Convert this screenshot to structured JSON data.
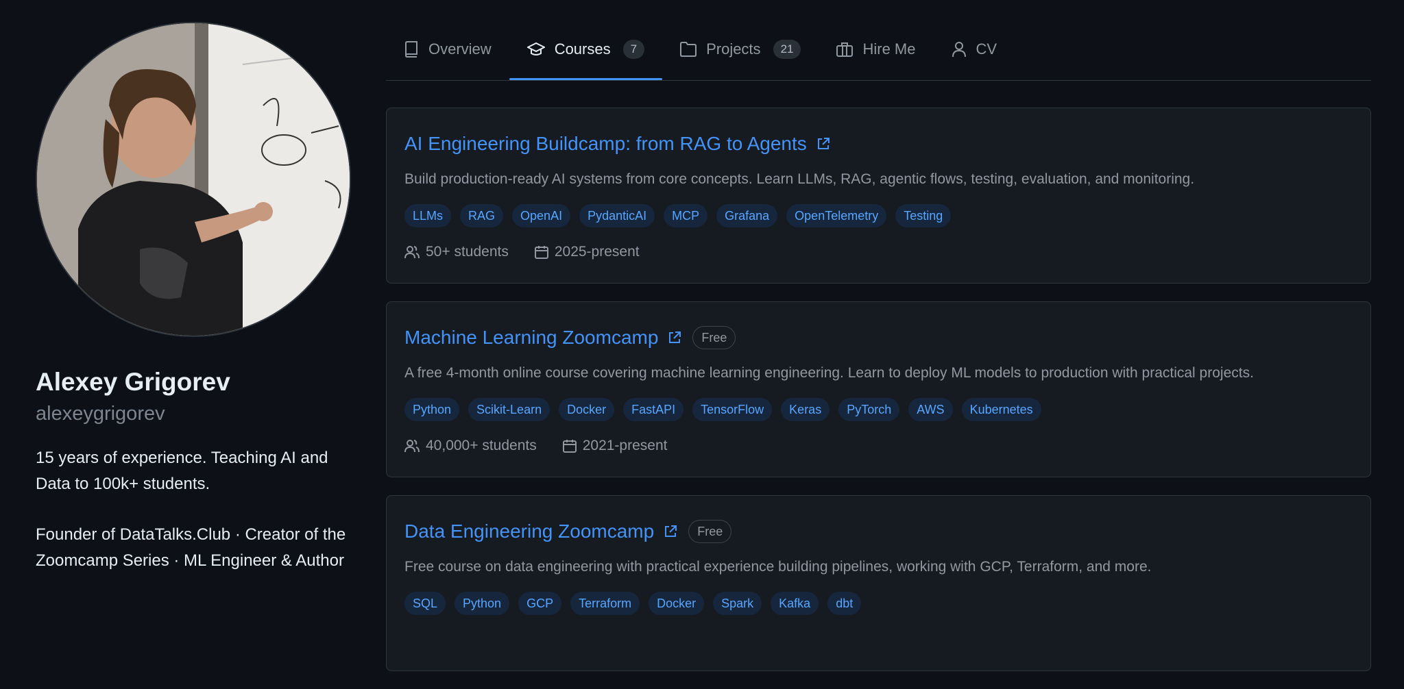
{
  "profile": {
    "name": "Alexey Grigorev",
    "username": "alexeygrigorev",
    "bio_line1": "15 years of experience. Teaching AI and Data to 100k+ students.",
    "bio_line2": "Founder of DataTalks.Club · Creator of the Zoomcamp Series · ML Engineer & Author"
  },
  "tabs": [
    {
      "label": "Overview",
      "icon": "book-icon",
      "count": null
    },
    {
      "label": "Courses",
      "icon": "graduation-cap-icon",
      "count": "7",
      "active": true
    },
    {
      "label": "Projects",
      "icon": "folder-icon",
      "count": "21"
    },
    {
      "label": "Hire Me",
      "icon": "briefcase-icon",
      "count": null
    },
    {
      "label": "CV",
      "icon": "person-icon",
      "count": null
    }
  ],
  "courses": [
    {
      "title": "AI Engineering Buildcamp: from RAG to Agents",
      "badge": "",
      "description": "Build production-ready AI systems from core concepts. Learn LLMs, RAG, agentic flows, testing, evaluation, and monitoring.",
      "tags": [
        "LLMs",
        "RAG",
        "OpenAI",
        "PydanticAI",
        "MCP",
        "Grafana",
        "OpenTelemetry",
        "Testing"
      ],
      "students": "50+ students",
      "period": "2025-present"
    },
    {
      "title": "Machine Learning Zoomcamp",
      "badge": "Free",
      "description": "A free 4-month online course covering machine learning engineering. Learn to deploy ML models to production with practical projects.",
      "tags": [
        "Python",
        "Scikit-Learn",
        "Docker",
        "FastAPI",
        "TensorFlow",
        "Keras",
        "PyTorch",
        "AWS",
        "Kubernetes"
      ],
      "students": "40,000+ students",
      "period": "2021-present"
    },
    {
      "title": "Data Engineering Zoomcamp",
      "badge": "Free",
      "description": "Free course on data engineering with practical experience building pipelines, working with GCP, Terraform, and more.",
      "tags": [
        "SQL",
        "Python",
        "GCP",
        "Terraform",
        "Docker",
        "Spark",
        "Kafka",
        "dbt"
      ],
      "students": "",
      "period": ""
    }
  ],
  "colors": {
    "background": "#0d1117",
    "card": "#161b22",
    "accent": "#4493f8",
    "muted": "#9198a1"
  }
}
